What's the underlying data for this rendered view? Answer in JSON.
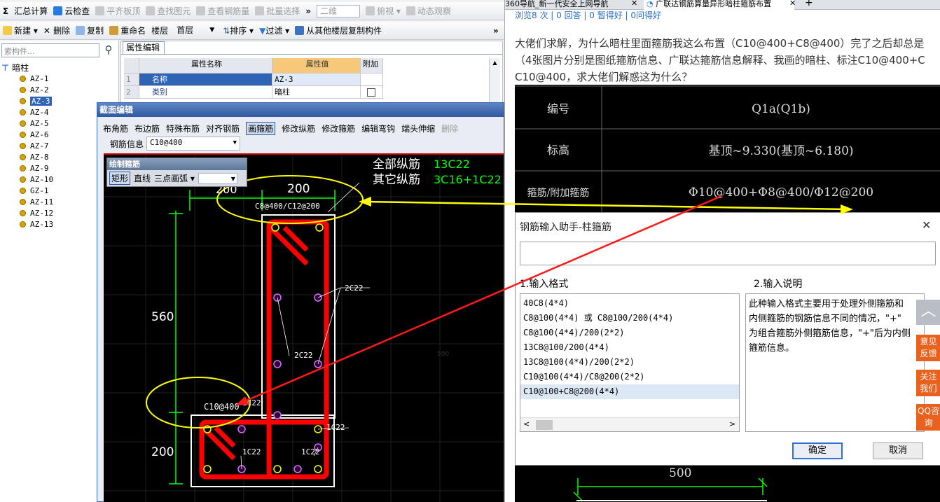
{
  "toolbar1": {
    "items": [
      "汇总计算",
      "云检查",
      "平齐板顶",
      "查找图元",
      "查看钢筋量",
      "批量选择",
      "二维",
      "俯视",
      "动态观察"
    ],
    "sigma": "Σ",
    "more": "»"
  },
  "toolbar2": {
    "new": "新建",
    "delete": "删除",
    "copy": "复制",
    "rename": "重命名",
    "floor_label": "楼层",
    "floor_value": "首层",
    "sort": "排序",
    "filter": "过滤",
    "copy_from": "从其他楼层复制构件",
    "more": "»"
  },
  "tree": {
    "search_placeholder": "索构件...",
    "root": "暗柱",
    "items": [
      "AZ-1",
      "AZ-2",
      "AZ-3",
      "AZ-4",
      "AZ-5",
      "AZ-6",
      "AZ-7",
      "AZ-8",
      "AZ-9",
      "AZ-10",
      "GZ-1",
      "AZ-11",
      "AZ-12",
      "AZ-13"
    ],
    "selected": "AZ-3"
  },
  "property_editor": {
    "tab": "属性编辑",
    "headers": [
      "属性名称",
      "属性值",
      "附加"
    ],
    "rows": [
      {
        "no": "1",
        "name": "名称",
        "value": "AZ-3"
      },
      {
        "no": "2",
        "name": "类别",
        "value": "暗柱"
      }
    ]
  },
  "section_editor": {
    "title": "截面编辑",
    "tools": [
      "布角筋",
      "布边筋",
      "特殊布筋",
      "对齐钢筋",
      "画箍筋",
      "修改纵筋",
      "修改箍筋",
      "编辑弯钩",
      "端头伸缩",
      "删除"
    ],
    "rebar_label": "钢筋信息",
    "rebar_value": "C10@400",
    "draw_panel": {
      "title": "绘制箍筋",
      "items": [
        "矩形",
        "直线",
        "三点画弧"
      ]
    }
  },
  "cad": {
    "label_all": "全部纵筋",
    "value_all": "13C22",
    "label_other": "其它纵筋",
    "value_other": "3C16+1C22",
    "dim_top_left": "200",
    "dim_top_right": "200",
    "dim_560": "560",
    "dim_200": "200",
    "stirrup_top": "C8@400/C12@200",
    "stirrup_bottom": "C10@400",
    "labels": [
      "2C22",
      "2C22",
      "1C22",
      "1C22",
      "1C22",
      "1C22"
    ],
    "faint": "500"
  },
  "browser": {
    "tab1": "360导航_新一代安全上网导航",
    "tab2": "广联达钢筋算量异形暗柱箍筋布置",
    "new_tab": "+",
    "stats": "浏览8 次 | 0 回答 | 0 暂得好 | 0问得好",
    "question_line1": "大佬们求解，为什么暗柱里面箍筋我这么布置（C10@400+C8@400）完了之后却总是",
    "question_line2": "（4张图片分别是图纸箍筋信息、广联达箍筋信息解释、我画的暗柱、标注C10@400+C",
    "question_line3": "C10@400，求大佬们解惑这为什么？"
  },
  "drawing": {
    "r1_label": "编号",
    "r1_value": "Q1a(Q1b)",
    "r2_label": "标高",
    "r2_value": "基顶~9.330(基顶~6.180)",
    "r3_label": "箍筋/附加箍筋",
    "r3_value": "Φ10@400+Φ8@400/Φ12@200",
    "bottom_dim": "500"
  },
  "helper_dialog": {
    "title": "钢筋输入助手-柱箍筋",
    "close": "✕",
    "sec1": "1.输入格式",
    "sec2": "2.输入说明",
    "formats": [
      "40C8(4*4)",
      "C8@100(4*4) 或 C8@100/200(4*4)",
      "C8@100(4*4)/200(2*2)",
      "13C8@100/200(4*4)",
      "13C8@100(4*4)/200(2*2)",
      "C10@100(4*4)/C8@200(2*2)",
      "C10@100+C8@200(4*4)"
    ],
    "selected_format": "C10@100+C8@200(4*4)",
    "desc_line1": "此种输入格式主要用于处理外侧箍筋和",
    "desc_line2": "内侧箍筋的钢筋信息不同的情况，\"+\"",
    "desc_line3": "为组合箍筋外侧箍筋信息，\"+\"后为内侧",
    "desc_line4": "箍筋信息。",
    "ok": "确定",
    "cancel": "取消"
  },
  "side_buttons": {
    "b1": "意见反馈",
    "b2": "关注我们",
    "b3": "QQ咨询"
  },
  "colors": {
    "accent": "#3a6bb3",
    "rebar_red": "#ff0000",
    "highlight_yellow": "#ffff00",
    "cad_green": "#00ff00",
    "side_orange": "#e8621e"
  }
}
